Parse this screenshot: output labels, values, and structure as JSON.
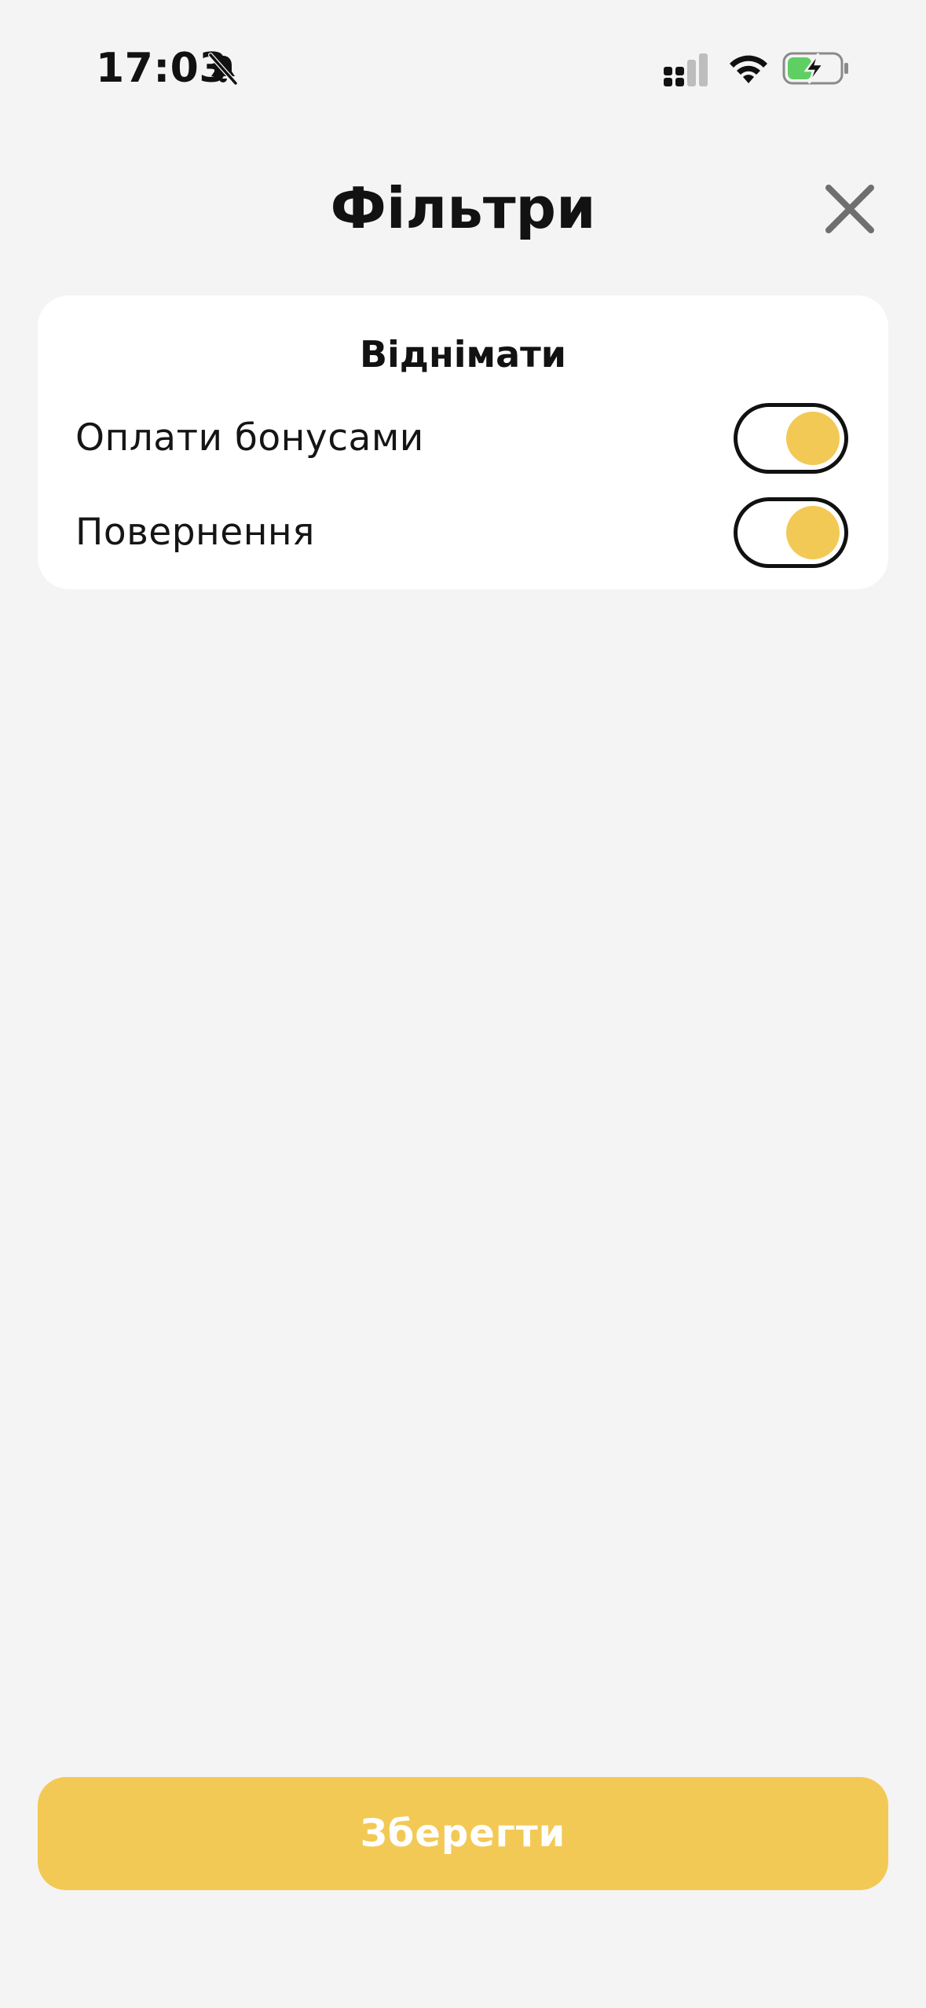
{
  "status_bar": {
    "time": "17:03",
    "icons": [
      "bell-slash-icon",
      "cellular-signal-icon",
      "wifi-icon",
      "battery-charging-icon"
    ]
  },
  "header": {
    "title": "Фільтри",
    "close_icon": "close-icon"
  },
  "filters": {
    "section_title": "Віднімати",
    "items": [
      {
        "label": "Оплати бонусами",
        "enabled": true
      },
      {
        "label": "Повернення",
        "enabled": true
      }
    ]
  },
  "footer": {
    "save_label": "Зберегти"
  },
  "colors": {
    "accent": "#f3c956",
    "background": "#f4f4f4",
    "card": "#ffffff",
    "text": "#121212"
  }
}
